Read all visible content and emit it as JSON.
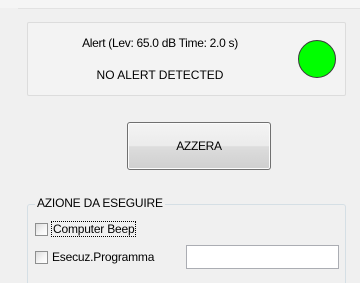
{
  "alert": {
    "info": "Alert (Lev: 65.0 dB Time: 2.0 s)",
    "status": "NO ALERT DETECTED",
    "indicator_color": "#00ff00"
  },
  "reset_button": {
    "label": "AZZERA"
  },
  "action_group": {
    "title": "AZIONE DA ESEGUIRE",
    "computer_beep": {
      "label": "Computer Beep",
      "checked": false
    },
    "run_program": {
      "label": "Esecuz.Programma",
      "checked": false,
      "value": ""
    }
  }
}
